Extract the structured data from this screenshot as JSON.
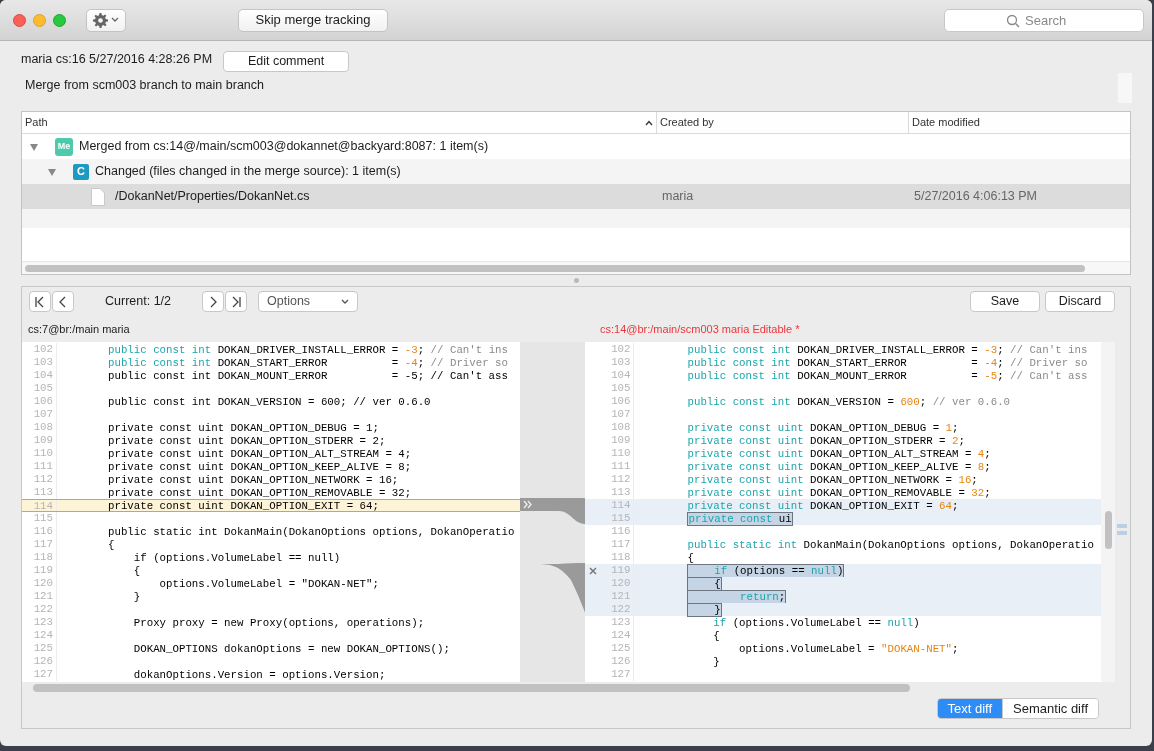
{
  "toolbar": {
    "skip_button": "Skip merge tracking",
    "search": {
      "placeholder": "Search"
    }
  },
  "changeset": {
    "info": "maria cs:16 5/27/2016 4:28:26 PM",
    "edit_button": "Edit comment",
    "comment": "Merge from scm003 branch to main branch"
  },
  "table": {
    "columns": [
      {
        "label": "Path",
        "sorted": true
      },
      {
        "label": "Created by",
        "sorted": false
      },
      {
        "label": "Date modified",
        "sorted": false
      }
    ],
    "rows": [
      {
        "kind": "merge",
        "badge": "Me",
        "label": "Merged from cs:14@/main/scm003@dokannet@backyard:8087: 1 item(s)",
        "expanded": true,
        "selected": false,
        "children": [
          {
            "kind": "changed",
            "badge": "C",
            "label": "Changed (files changed in the merge source): 1 item(s)",
            "expanded": true,
            "selected": false,
            "children": [
              {
                "kind": "file",
                "label": "/DokanNet/Properties/DokanNet.cs",
                "created_by": "maria",
                "date_modified": "5/27/2016 4:06:13 PM",
                "selected": true
              }
            ]
          }
        ]
      }
    ]
  },
  "diff_toolbar": {
    "current": "Current: 1/2",
    "options": "Options",
    "save": "Save",
    "discard": "Discard"
  },
  "left_pane": {
    "header": "cs:7@br:/main maria",
    "editable": false,
    "lines": [
      {
        "number": "102",
        "kind": "normal",
        "segments": [
          {
            "kind": "kw",
            "text": "public const int"
          },
          {
            "kind": "plain",
            "text": " DOKAN_DRIVER_INSTALL_ERROR = "
          },
          {
            "kind": "num",
            "text": "-3"
          },
          {
            "kind": "plain",
            "text": "; "
          },
          {
            "kind": "comment",
            "text": "// Can't ins"
          }
        ]
      },
      {
        "number": "103",
        "kind": "normal",
        "segments": [
          {
            "kind": "kw",
            "text": "public const int"
          },
          {
            "kind": "plain",
            "text": " DOKAN_START_ERROR          = "
          },
          {
            "kind": "num",
            "text": "-4"
          },
          {
            "kind": "plain",
            "text": "; "
          },
          {
            "kind": "comment",
            "text": "// Driver so"
          }
        ]
      },
      {
        "number": "104",
        "kind": "normal",
        "segments": [
          {
            "kind": "plain",
            "text": "public const int DOKAN_MOUNT_ERROR          = -5; // Can't ass"
          }
        ]
      },
      {
        "number": "105",
        "kind": "normal"
      },
      {
        "number": "106",
        "kind": "normal",
        "segments": [
          {
            "kind": "plain",
            "text": "public const int DOKAN_VERSION = 600; // ver 0.6.0"
          }
        ]
      },
      {
        "number": "107",
        "kind": "normal"
      },
      {
        "number": "108",
        "kind": "normal",
        "segments": [
          {
            "kind": "plain",
            "text": "private const uint DOKAN_OPTION_DEBUG = 1;"
          }
        ]
      },
      {
        "number": "109",
        "kind": "normal",
        "segments": [
          {
            "kind": "plain",
            "text": "private const uint DOKAN_OPTION_STDERR = 2;"
          }
        ]
      },
      {
        "number": "110",
        "kind": "normal",
        "segments": [
          {
            "kind": "plain",
            "text": "private const uint DOKAN_OPTION_ALT_STREAM = 4;"
          }
        ]
      },
      {
        "number": "111",
        "kind": "normal",
        "segments": [
          {
            "kind": "plain",
            "text": "private const uint DOKAN_OPTION_KEEP_ALIVE = 8;"
          }
        ]
      },
      {
        "number": "112",
        "kind": "normal",
        "segments": [
          {
            "kind": "plain",
            "text": "private const uint DOKAN_OPTION_NETWORK = 16;"
          }
        ]
      },
      {
        "number": "113",
        "kind": "normal",
        "segments": [
          {
            "kind": "plain",
            "text": "private const uint DOKAN_OPTION_REMOVABLE = 32;"
          }
        ]
      },
      {
        "number": "114",
        "kind": "current",
        "segments": [
          {
            "kind": "plain",
            "text": "private const uint DOKAN_OPTION_EXIT = 64;"
          }
        ]
      },
      {
        "number": "115",
        "kind": "normal"
      },
      {
        "number": "116",
        "kind": "normal",
        "segments": [
          {
            "kind": "plain",
            "text": "public static int DokanMain(DokanOptions options, DokanOperatio"
          }
        ]
      },
      {
        "number": "117",
        "kind": "normal",
        "segments": [
          {
            "kind": "plain",
            "text": "{"
          }
        ]
      },
      {
        "number": "118",
        "kind": "normal",
        "segments": [
          {
            "kind": "plain",
            "text": "    if (options.VolumeLabel == null)"
          }
        ]
      },
      {
        "number": "119",
        "kind": "normal",
        "segments": [
          {
            "kind": "plain",
            "text": "    {"
          }
        ]
      },
      {
        "number": "120",
        "kind": "normal",
        "segments": [
          {
            "kind": "plain",
            "text": "        options.VolumeLabel = \"DOKAN-NET\";"
          }
        ]
      },
      {
        "number": "121",
        "kind": "normal",
        "segments": [
          {
            "kind": "plain",
            "text": "    }"
          }
        ]
      },
      {
        "number": "122",
        "kind": "normal"
      },
      {
        "number": "123",
        "kind": "normal",
        "segments": [
          {
            "kind": "plain",
            "text": "    Proxy proxy = new Proxy(options, operations);"
          }
        ]
      },
      {
        "number": "124",
        "kind": "normal"
      },
      {
        "number": "125",
        "kind": "normal",
        "segments": [
          {
            "kind": "plain",
            "text": "    DOKAN_OPTIONS dokanOptions = new DOKAN_OPTIONS();"
          }
        ]
      },
      {
        "number": "126",
        "kind": "normal"
      },
      {
        "number": "127",
        "kind": "normal",
        "segments": [
          {
            "kind": "plain",
            "text": "    dokanOptions.Version = options.Version;"
          }
        ]
      }
    ]
  },
  "right_pane": {
    "header": "cs:14@br:/main/scm003 maria Editable *",
    "editable": true,
    "lines": [
      {
        "number": "102",
        "kind": "normal",
        "segments": [
          {
            "kind": "kw",
            "text": "public const int"
          },
          {
            "kind": "plain",
            "text": " DOKAN_DRIVER_INSTALL_ERROR = "
          },
          {
            "kind": "num",
            "text": "-3"
          },
          {
            "kind": "plain",
            "text": "; "
          },
          {
            "kind": "comment",
            "text": "// Can't ins"
          }
        ]
      },
      {
        "number": "103",
        "kind": "normal",
        "segments": [
          {
            "kind": "kw",
            "text": "public const int"
          },
          {
            "kind": "plain",
            "text": " DOKAN_START_ERROR          = "
          },
          {
            "kind": "num",
            "text": "-4"
          },
          {
            "kind": "plain",
            "text": "; "
          },
          {
            "kind": "comment",
            "text": "// Driver so"
          }
        ]
      },
      {
        "number": "104",
        "kind": "normal",
        "segments": [
          {
            "kind": "kw",
            "text": "public const int"
          },
          {
            "kind": "plain",
            "text": " DOKAN_MOUNT_ERROR          = "
          },
          {
            "kind": "num",
            "text": "-5"
          },
          {
            "kind": "plain",
            "text": "; "
          },
          {
            "kind": "comment",
            "text": "// Can't ass"
          }
        ]
      },
      {
        "number": "105",
        "kind": "normal"
      },
      {
        "number": "106",
        "kind": "normal",
        "segments": [
          {
            "kind": "kw",
            "text": "public const int"
          },
          {
            "kind": "plain",
            "text": " DOKAN_VERSION = "
          },
          {
            "kind": "num",
            "text": "600"
          },
          {
            "kind": "plain",
            "text": "; "
          },
          {
            "kind": "comment",
            "text": "// ver 0.6.0"
          }
        ]
      },
      {
        "number": "107",
        "kind": "normal"
      },
      {
        "number": "108",
        "kind": "normal",
        "segments": [
          {
            "kind": "kw",
            "text": "private const uint"
          },
          {
            "kind": "plain",
            "text": " DOKAN_OPTION_DEBUG = "
          },
          {
            "kind": "num",
            "text": "1"
          },
          {
            "kind": "plain",
            "text": ";"
          }
        ]
      },
      {
        "number": "109",
        "kind": "normal",
        "segments": [
          {
            "kind": "kw",
            "text": "private const uint"
          },
          {
            "kind": "plain",
            "text": " DOKAN_OPTION_STDERR = "
          },
          {
            "kind": "num",
            "text": "2"
          },
          {
            "kind": "plain",
            "text": ";"
          }
        ]
      },
      {
        "number": "110",
        "kind": "normal",
        "segments": [
          {
            "kind": "kw",
            "text": "private const uint"
          },
          {
            "kind": "plain",
            "text": " DOKAN_OPTION_ALT_STREAM = "
          },
          {
            "kind": "num",
            "text": "4"
          },
          {
            "kind": "plain",
            "text": ";"
          }
        ]
      },
      {
        "number": "111",
        "kind": "normal",
        "segments": [
          {
            "kind": "kw",
            "text": "private const uint"
          },
          {
            "kind": "plain",
            "text": " DOKAN_OPTION_KEEP_ALIVE = "
          },
          {
            "kind": "num",
            "text": "8"
          },
          {
            "kind": "plain",
            "text": ";"
          }
        ]
      },
      {
        "number": "112",
        "kind": "normal",
        "segments": [
          {
            "kind": "kw",
            "text": "private const uint"
          },
          {
            "kind": "plain",
            "text": " DOKAN_OPTION_NETWORK = "
          },
          {
            "kind": "num",
            "text": "16"
          },
          {
            "kind": "plain",
            "text": ";"
          }
        ]
      },
      {
        "number": "113",
        "kind": "normal",
        "segments": [
          {
            "kind": "kw",
            "text": "private const uint"
          },
          {
            "kind": "plain",
            "text": " DOKAN_OPTION_REMOVABLE = "
          },
          {
            "kind": "num",
            "text": "32"
          },
          {
            "kind": "plain",
            "text": ";"
          }
        ]
      },
      {
        "number": "114",
        "kind": "added",
        "segments": [
          {
            "kind": "kw",
            "text": "private const uint"
          },
          {
            "kind": "plain",
            "text": " DOKAN_OPTION_EXIT = "
          },
          {
            "kind": "num",
            "text": "64"
          },
          {
            "kind": "plain",
            "text": ";"
          }
        ]
      },
      {
        "number": "115",
        "kind": "marked",
        "segments": [
          {
            "kind": "kw",
            "text": "private const"
          },
          {
            "kind": "plain",
            "text": " ui"
          }
        ]
      },
      {
        "number": "116",
        "kind": "normal"
      },
      {
        "number": "117",
        "kind": "normal",
        "segments": [
          {
            "kind": "kw",
            "text": "public static int"
          },
          {
            "kind": "plain",
            "text": " DokanMain(DokanOptions options, DokanOperatio"
          }
        ]
      },
      {
        "number": "118",
        "kind": "normal",
        "segments": [
          {
            "kind": "plain",
            "text": "{"
          }
        ]
      },
      {
        "number": "119",
        "kind": "marked",
        "discard": true,
        "segments": [
          {
            "kind": "kw",
            "text": "    if"
          },
          {
            "kind": "plain",
            "text": " (options == "
          },
          {
            "kind": "kw",
            "text": "null"
          },
          {
            "kind": "plain",
            "text": ")"
          }
        ]
      },
      {
        "number": "120",
        "kind": "marked",
        "segments": [
          {
            "kind": "plain",
            "text": "    {"
          }
        ]
      },
      {
        "number": "121",
        "kind": "marked",
        "segments": [
          {
            "kind": "kw",
            "text": "        return"
          },
          {
            "kind": "plain",
            "text": ";"
          }
        ]
      },
      {
        "number": "122",
        "kind": "marked",
        "segments": [
          {
            "kind": "plain",
            "text": "    }"
          }
        ]
      },
      {
        "number": "123",
        "kind": "normal",
        "segments": [
          {
            "kind": "kw",
            "text": "    if"
          },
          {
            "kind": "plain",
            "text": " (options.VolumeLabel == "
          },
          {
            "kind": "kw",
            "text": "null"
          },
          {
            "kind": "plain",
            "text": ")"
          }
        ]
      },
      {
        "number": "124",
        "kind": "normal",
        "segments": [
          {
            "kind": "plain",
            "text": "    {"
          }
        ]
      },
      {
        "number": "125",
        "kind": "normal",
        "segments": [
          {
            "kind": "plain",
            "text": "        options.VolumeLabel = "
          },
          {
            "kind": "str",
            "text": "\"DOKAN-NET\""
          },
          {
            "kind": "plain",
            "text": ";"
          }
        ]
      },
      {
        "number": "126",
        "kind": "normal",
        "segments": [
          {
            "kind": "plain",
            "text": "    }"
          }
        ]
      },
      {
        "number": "127",
        "kind": "normal"
      }
    ]
  },
  "diff_modes": [
    {
      "label": "Text diff",
      "selected": true
    },
    {
      "label": "Semantic diff",
      "selected": false
    }
  ]
}
